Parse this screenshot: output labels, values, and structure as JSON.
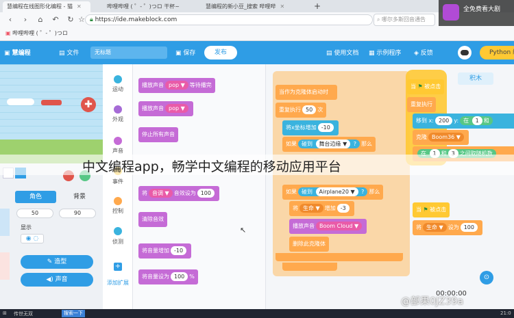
{
  "browser": {
    "tabs": [
      {
        "label": "慧编程在线图形化编程 - 猫"
      },
      {
        "label": "哔哩哔哩 ( ゜- ゜)つロ"
      },
      {
        "label": "哔哩哔哩 ( ゜- ゜)つロ 干杯~"
      },
      {
        "label": "慧编程的新小豆_搜索 哔哩哔"
      }
    ],
    "url": "https://ide.makeblock.com",
    "bookmarks": [
      "哔哩哔哩 ( ゜- ゜)つロ"
    ],
    "search_placeholder": "哪尔多斯回音通告"
  },
  "app": {
    "logo": "慧编程",
    "file_menu": "文件",
    "project_title": "无标题",
    "save_label": "保存",
    "publish_label": "发布",
    "docs_label": "使用文档",
    "examples_label": "示例程序",
    "feedback_label": "反馈",
    "python_label": "Python 编"
  },
  "categories": [
    {
      "label": "运动",
      "color": "#3ab3de"
    },
    {
      "label": "外观",
      "color": "#a66bd6"
    },
    {
      "label": "声音",
      "color": "#c56bd6"
    },
    {
      "label": "事件",
      "color": "#ffc933"
    },
    {
      "label": "控制",
      "color": "#ffa94d"
    },
    {
      "label": "侦测",
      "color": "#3ab3de"
    }
  ],
  "extend_label": "添加扩展",
  "palette": [
    {
      "text": "播放声音",
      "pill": "pop ▼",
      "tail": "等待播完"
    },
    {
      "text": "播放声音",
      "pill": "pop ▼",
      "tail": ""
    },
    {
      "text": "停止所有声音",
      "pill": "",
      "tail": ""
    },
    {
      "text": "将",
      "pill": "音调 ▼",
      "tail": "音效设为",
      "value": "100"
    },
    {
      "text": "清除音效",
      "pill": "",
      "tail": ""
    },
    {
      "text": "将音量增加",
      "pill": "",
      "tail": "",
      "value": "-10"
    },
    {
      "text": "将音量设为",
      "pill": "",
      "tail": "%",
      "value": "100"
    }
  ],
  "sprite_panel": {
    "tab_role": "角色",
    "tab_bg": "背景",
    "x_value": "50",
    "y_value": "90",
    "show_label": "显示",
    "costume_btn": "造型",
    "sound_btn": "声音"
  },
  "workspace": {
    "script1": {
      "hat": "当作为克隆体启动时",
      "repeat": "重复执行",
      "repeat_value": "50",
      "repeat_tail": "次",
      "change_x": "将x坐标增加",
      "change_x_value": "-10",
      "if1": "如果",
      "touching1": "碰到",
      "touching1_target": "舞台边缘 ▼",
      "then1": "那么",
      "if2": "如果",
      "touching2": "碰到",
      "touching2_target": "Airplane20 ▼",
      "then2": "那么",
      "set_var": "将",
      "var_name": "生命 ▼",
      "set_var_tail": "增加",
      "set_var_value": "-3",
      "play_sound": "播放声音",
      "sound_name": "Boom Cloud ▼",
      "delete_clone": "删除此克隆体"
    },
    "script2": {
      "hat": "当",
      "hat_tail": "被点击",
      "forever": "重复执行",
      "move": "移到 x:",
      "x": "200",
      "y_label": "y:",
      "y_expr_op": "在",
      "y_a": "1",
      "y_b": "和",
      "costume": "克隆",
      "costume_target": "Boom36 ▼",
      "wait": "在",
      "wait_a": "1",
      "wait_b": "和",
      "wait_c": "3",
      "wait_tail": "之间取随机数"
    },
    "script3": {
      "hat": "当",
      "hat_tail": "被点击",
      "set": "将",
      "var": "生命 ▼",
      "set_tail": "设为",
      "value": "100"
    },
    "tab_blocks": "积木"
  },
  "overlay_caption": "中文编程app，畅学中文编程的移动应用平台",
  "watermark_tr": "全免费看大剧",
  "video_time": "00:00:00",
  "watermark_br": "@部果0JZ39a",
  "taskbar": {
    "item1": "传世无双",
    "item2": "搜索一下",
    "time": "21:0"
  }
}
